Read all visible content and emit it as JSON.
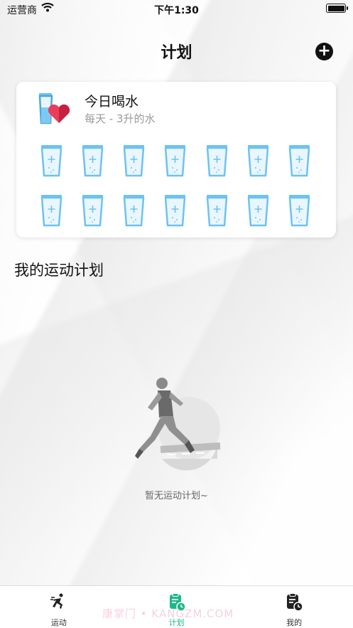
{
  "status_bar": {
    "carrier": "运营商",
    "time": "下午1:30"
  },
  "header": {
    "title": "计划",
    "add_icon": "plus-circle-icon"
  },
  "water_card": {
    "icon": "water-cup-heart-icon",
    "title": "今日喝水",
    "subtitle": "每天 - 3升的水",
    "cup_icon": "water-cup-plus-icon",
    "cup_rows": 2,
    "cups_per_row": 7,
    "accent": "#6cc3f0"
  },
  "section": {
    "title": "我的运动计划"
  },
  "empty_state": {
    "illustration": "runner-illustration",
    "text": "暂无运动计划~"
  },
  "tab_bar": {
    "active_color": "#19b98b",
    "tabs": [
      {
        "label": "运动",
        "icon": "runner-icon"
      },
      {
        "label": "计划",
        "icon": "plan-clipboard-icon",
        "active": true
      },
      {
        "label": "我的",
        "icon": "profile-clipboard-icon"
      }
    ]
  },
  "watermark": {
    "text": "康掌门 • KANGZM.COM"
  }
}
